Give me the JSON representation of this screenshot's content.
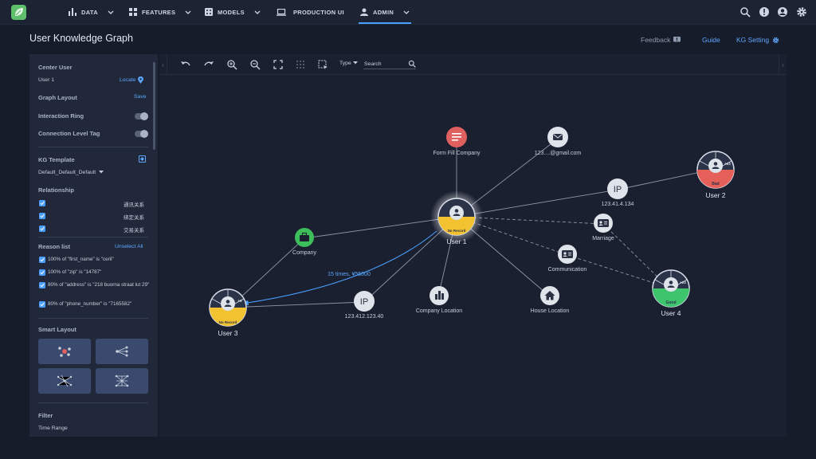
{
  "nav": {
    "items": [
      {
        "label": "DATA",
        "icon": "bar-chart-icon"
      },
      {
        "label": "FEATURES",
        "icon": "features-grid-icon"
      },
      {
        "label": "MODELS",
        "icon": "dice-icon"
      },
      {
        "label": "PRODUCTION UI",
        "icon": "laptop-icon"
      },
      {
        "label": "ADMIN",
        "icon": "person-icon"
      }
    ],
    "active": "ADMIN",
    "right_icons": [
      "search-icon",
      "alert-icon",
      "account-icon",
      "settings-icon"
    ]
  },
  "page": {
    "title": "User Knowledge Graph",
    "feedback": "Feedback",
    "guide": "Guide",
    "kg_setting": "KG Setting"
  },
  "left": {
    "center_user_label": "Center User",
    "center_user_value": "User 1",
    "locate": "Locate",
    "graph_layout": "Graph Layout",
    "save": "Save",
    "interaction_ring": "Interaction Ring",
    "connection_level_tag": "Connection Level Tag",
    "kg_template": "KG Template",
    "template_value": "Default_Default_Default",
    "relationship": "Relationship",
    "relations": [
      {
        "text": "通讯关系",
        "style": "dashed"
      },
      {
        "text": "绑定关系",
        "style": "solid"
      },
      {
        "text": "交易关系",
        "style": "arrow"
      }
    ],
    "reason_list": "Reason list",
    "unselect_all": "Unselect All",
    "reasons": [
      "100% of \"first_name\" is \"ceril\"",
      "100% of \"zip\" is \"14787\"",
      "80% of \"address\" is \"218 buorna straat lut 29\"",
      "80% of \"phone_number\" is \"7165582\""
    ],
    "smart_layout": "Smart Layout",
    "filter": "Filter",
    "time_range": "Time Range"
  },
  "toolbar": {
    "type": "Type",
    "search_placeholder": "Search"
  },
  "graph": {
    "users": [
      {
        "id": "u1",
        "label": "User 1",
        "status": "No Record",
        "status_color": "#f2c230"
      },
      {
        "id": "u2",
        "label": "User 2",
        "status": "Bad",
        "status_color": "#e6605a",
        "count": "+23"
      },
      {
        "id": "u3",
        "label": "User 3",
        "status": "No Record",
        "status_color": "#f2c230",
        "count": "+6"
      },
      {
        "id": "u4",
        "label": "User 4",
        "status": "Good",
        "status_color": "#3ec46d",
        "count": "+23"
      }
    ],
    "nodes": [
      {
        "id": "form",
        "label": "Form Fill Company",
        "icon": "form-icon",
        "color": "#e05f5f"
      },
      {
        "id": "email",
        "label": "123....@gmail.com",
        "icon": "mail-icon",
        "color": "#dfe3ea"
      },
      {
        "id": "ip1",
        "label": "123.41.4.134",
        "icon": "ip-icon",
        "color": "#dfe3ea"
      },
      {
        "id": "marriage",
        "label": "Marriage",
        "icon": "id-card-icon",
        "color": "#dfe3ea"
      },
      {
        "id": "comm",
        "label": "Communication",
        "icon": "id-card-icon",
        "color": "#dfe3ea"
      },
      {
        "id": "company",
        "label": "Company",
        "icon": "briefcase-icon",
        "color": "#3ebd5b"
      },
      {
        "id": "ip2",
        "label": "123.412.123.40",
        "icon": "ip-icon",
        "color": "#dfe3ea"
      },
      {
        "id": "cloc",
        "label": "Company Location",
        "icon": "building-icon",
        "color": "#dfe3ea"
      },
      {
        "id": "hloc",
        "label": "House Location",
        "icon": "house-icon",
        "color": "#dfe3ea"
      }
    ],
    "transaction_label": "15 times, ¥56000",
    "ip_text": "IP"
  },
  "colors": {
    "accent": "#4a9fff",
    "background": "#161c2a",
    "panel": "#20283a",
    "canvas": "#1a2030"
  }
}
